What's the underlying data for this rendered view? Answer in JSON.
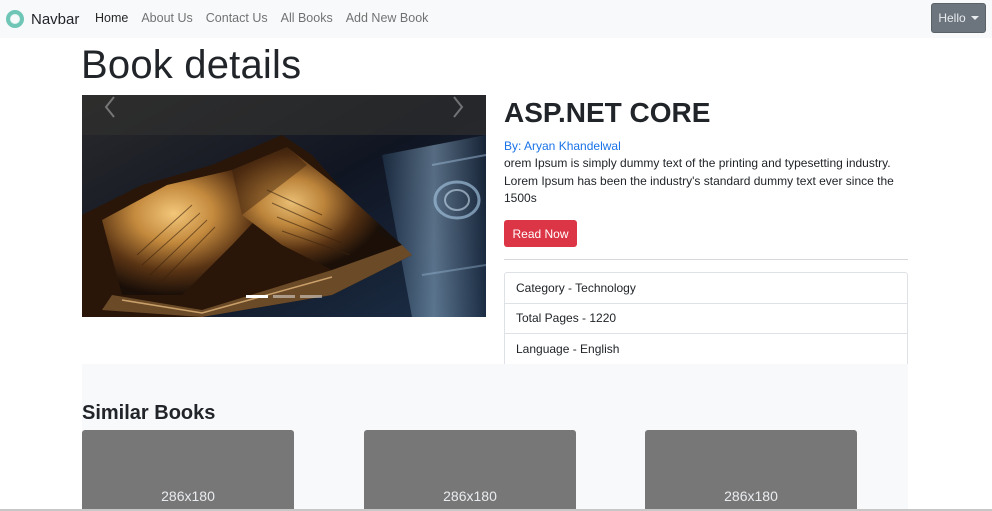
{
  "navbar": {
    "brand": "Navbar",
    "links": [
      {
        "label": "Home",
        "active": true
      },
      {
        "label": "About Us",
        "active": false
      },
      {
        "label": "Contact Us",
        "active": false
      },
      {
        "label": "All Books",
        "active": false
      },
      {
        "label": "Add New Book",
        "active": false
      }
    ],
    "user_menu_label": "Hello"
  },
  "page": {
    "title": "Book details"
  },
  "carousel": {
    "slide_count": 3,
    "active_slide": 1
  },
  "book": {
    "title": "ASP.NET CORE",
    "author": "By: Aryan Khandelwal",
    "description": "orem Ipsum is simply dummy text of the printing and typesetting industry. Lorem Ipsum has been the industry's standard dummy text ever since the 1500s",
    "read_button": "Read Now",
    "details": [
      "Category - Technology",
      "Total Pages - 1220",
      "Language - English"
    ]
  },
  "similar": {
    "title": "Similar Books",
    "cards": [
      {
        "placeholder": "286x180"
      },
      {
        "placeholder": "286x180"
      },
      {
        "placeholder": "286x180"
      }
    ]
  },
  "colors": {
    "navbar_bg": "#f8f9fa",
    "link_blue": "#1a73e8",
    "danger": "#dc3545",
    "secondary": "#6c757d",
    "placeholder_gray": "#777777"
  }
}
